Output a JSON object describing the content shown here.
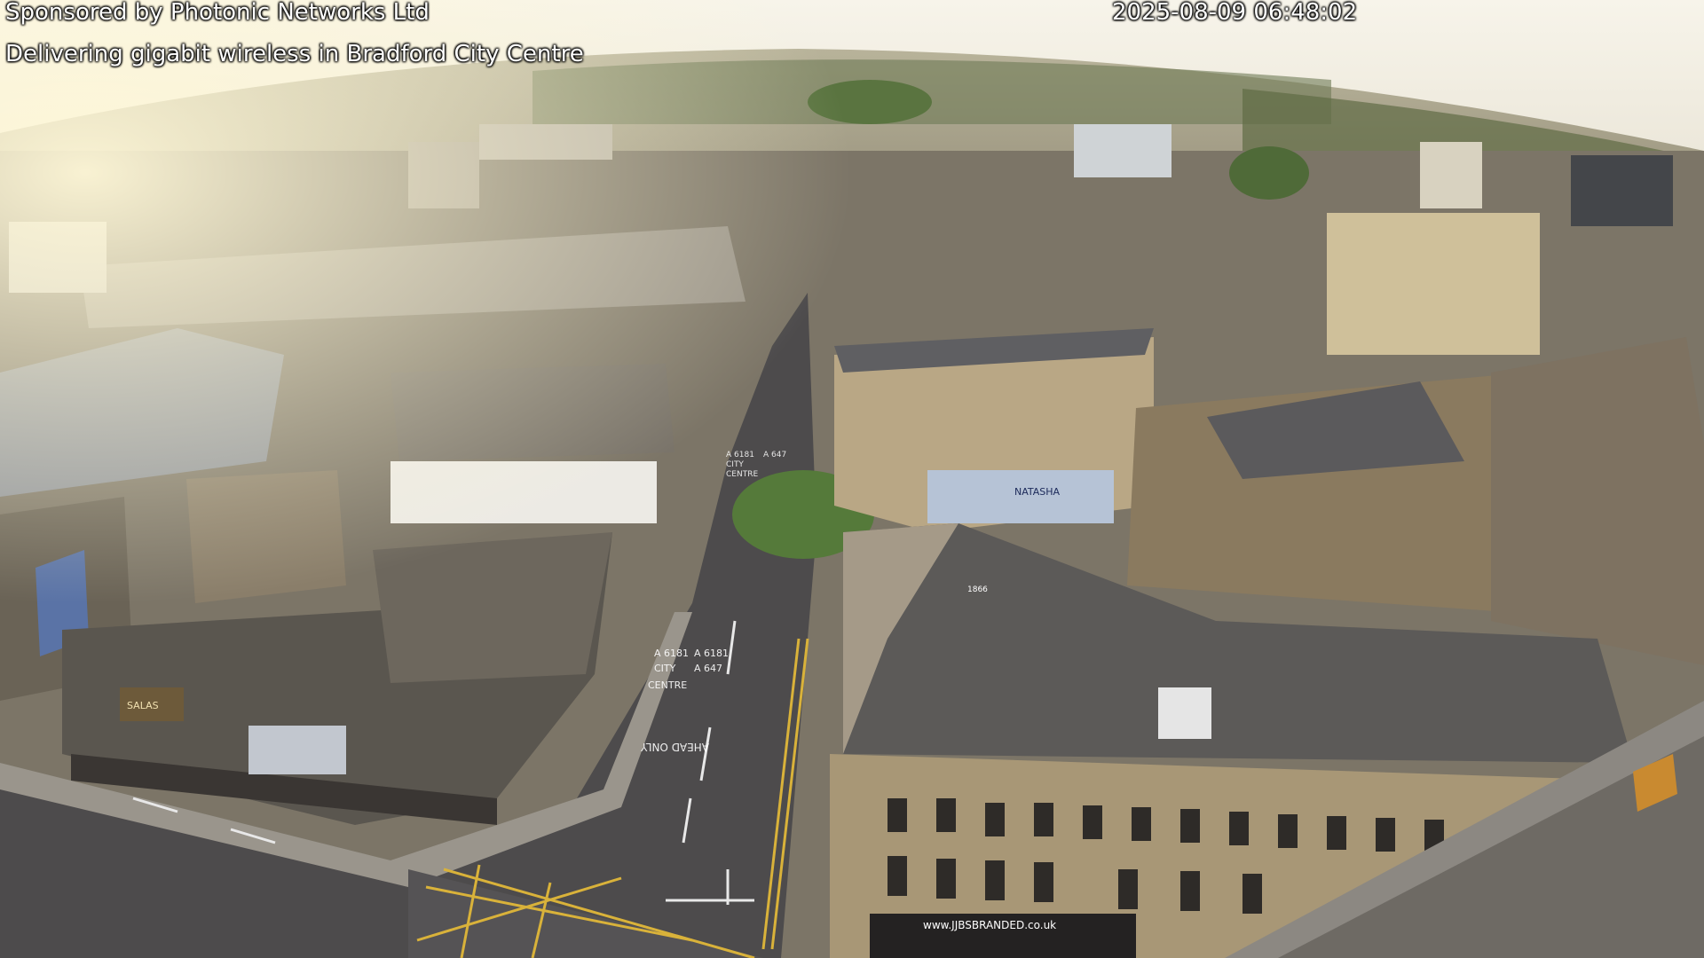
{
  "camera_overlay": {
    "sponsor": "Sponsored by Photonic Networks Ltd",
    "tagline": "Delivering gigabit wireless in Bradford City Centre",
    "timestamp": "2025-08-09 06:48:02"
  },
  "scene": {
    "road_markings": {
      "upper": [
        "A 6181",
        "A 647",
        "CITY",
        "CENTRE"
      ],
      "lower": [
        "A 6181",
        "A 6181",
        "CITY",
        "A 647",
        "CENTRE"
      ],
      "ahead_only": "AHEAD ONLY"
    },
    "signs": {
      "salas": "SALAS",
      "natasha": "NATASHA",
      "website": "www.JJBSBRANDED.co.uk",
      "date_stone": "1866"
    }
  }
}
